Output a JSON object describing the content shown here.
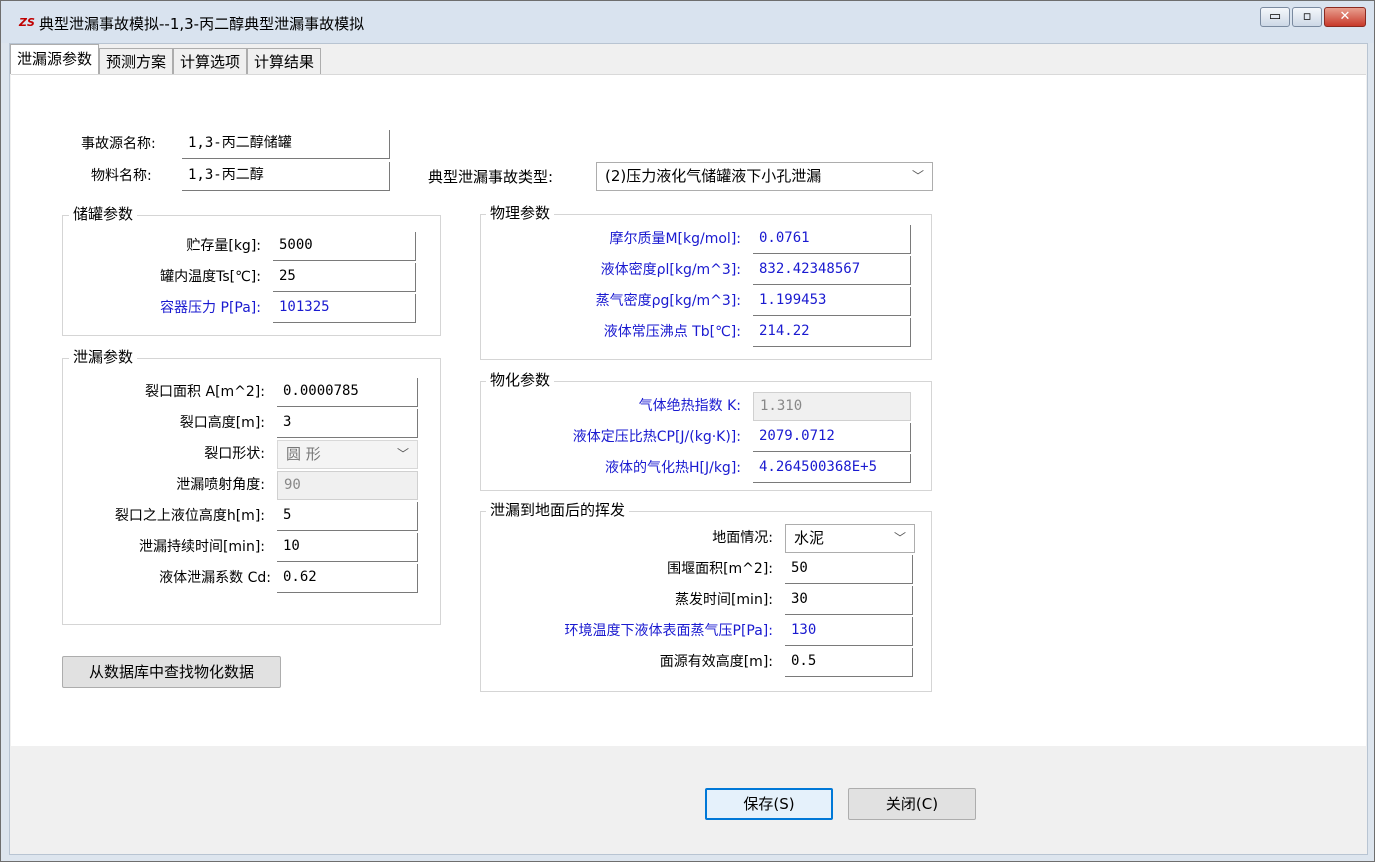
{
  "window": {
    "title": "典型泄漏事故模拟--1,3-丙二醇典型泄漏事故模拟",
    "app_icon": "ZS",
    "minimize_glyph": "▭",
    "restore_glyph": "▫",
    "close_glyph": "✕"
  },
  "tabs": [
    "泄漏源参数",
    "预测方案",
    "计算选项",
    "计算结果"
  ],
  "header": {
    "source_name_label": "事故源名称:",
    "source_name_value": "1,3-丙二醇储罐",
    "material_label": "物料名称:",
    "material_value": "1,3-丙二醇",
    "accident_type_label": "典型泄漏事故类型:",
    "accident_type_value": "(2)压力液化气储罐液下小孔泄漏"
  },
  "tank": {
    "title": "储罐参数",
    "fields": [
      {
        "label": "贮存量[kg]:",
        "value": "5000"
      },
      {
        "label": "罐内温度Ts[℃]:",
        "value": "25"
      },
      {
        "label": "容器压力 P[Pa]:",
        "value": "101325"
      }
    ]
  },
  "leak": {
    "title": "泄漏参数",
    "area_label": "裂口面积 A[m^2]:",
    "area_value": "0.0000785",
    "height_label": "裂口高度[m]:",
    "height_value": "3",
    "shape_label": "裂口形状:",
    "shape_value": "圆 形",
    "angle_label": "泄漏喷射角度:",
    "angle_value": "90",
    "level_label": "裂口之上液位高度h[m]:",
    "level_value": "5",
    "duration_label": "泄漏持续时间[min]:",
    "duration_value": "10",
    "cd_label": "液体泄漏系数 Cd:",
    "cd_value": "0.62"
  },
  "physical": {
    "title": "物理参数",
    "fields": [
      {
        "label": "摩尔质量M[kg/mol]:",
        "value": "0.0761"
      },
      {
        "label": "液体密度ρl[kg/m^3]:",
        "value": "832.42348567"
      },
      {
        "label": "蒸气密度ρg[kg/m^3]:",
        "value": "1.199453"
      },
      {
        "label": "液体常压沸点 Tb[℃]:",
        "value": "214.22"
      }
    ]
  },
  "physchem": {
    "title": "物化参数",
    "fields": [
      {
        "label": "气体绝热指数 K:",
        "value": "1.310"
      },
      {
        "label": "液体定压比热CP[J/(kg·K)]:",
        "value": "2079.0712"
      },
      {
        "label": "液体的气化热H[J/kg]:",
        "value": "4.264500368E+5"
      }
    ]
  },
  "evap": {
    "title": "泄漏到地面后的挥发",
    "ground_label": "地面情况:",
    "ground_value": "水泥",
    "dike_label": "围堰面积[m^2]:",
    "dike_value": "50",
    "time_label": "蒸发时间[min]:",
    "time_value": "30",
    "vp_label": "环境温度下液体表面蒸气压P[Pa]:",
    "vp_value": "130",
    "src_height_label": "面源有效高度[m]:",
    "src_height_value": "0.5"
  },
  "buttons": {
    "lookup": "从数据库中查找物化数据",
    "save": "保存(S)",
    "close": "关闭(C)"
  },
  "colors": {
    "blue_label": "#1a1ad0",
    "primary_border": "#0078d7"
  }
}
